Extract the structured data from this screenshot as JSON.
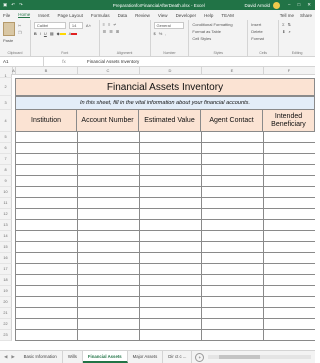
{
  "window": {
    "title": "PreparationforFinancialAfterDeath.xlsx - Excel",
    "user": "David Arnold",
    "controls": [
      "–",
      "□",
      "✕"
    ]
  },
  "qat": {
    "save": "▣",
    "undo": "↶",
    "redo": "↷"
  },
  "menu": {
    "tabs": [
      "File",
      "Home",
      "Insert",
      "Page Layout",
      "Formulas",
      "Data",
      "Review",
      "View",
      "Developer",
      "Help",
      "TEAM"
    ],
    "active": "Home",
    "tell_me": "Tell me",
    "share": "Share"
  },
  "ribbon": {
    "paste": "Paste",
    "font_name": "Calibri",
    "font_size": "14",
    "general": "General",
    "conditional": "Conditional Formatting",
    "format_table": "Format as Table",
    "cell_styles": "Cell Styles",
    "insert": "Insert",
    "delete": "Delete",
    "format": "Format",
    "groups": [
      "Clipboard",
      "Font",
      "Alignment",
      "Number",
      "Styles",
      "Cells",
      "Editing"
    ]
  },
  "formula_bar": {
    "name_box": "A1",
    "fx": "fx",
    "formula": "Financial Assets Inventory"
  },
  "columns": [
    "A",
    "B",
    "C",
    "D",
    "E",
    "F"
  ],
  "sheet": {
    "title": "Financial Assets Inventory",
    "subtitle": "In this sheet, fill in the vital information about your financial accounts.",
    "headers": [
      "Institution",
      "Account Number",
      "Estimated Value",
      "Agent Contact",
      "Intended Beneficiary"
    ],
    "row_numbers": [
      "1",
      "2",
      "3",
      "4",
      "5",
      "6",
      "7",
      "8",
      "9",
      "10",
      "11",
      "12",
      "13",
      "14",
      "15",
      "16",
      "17",
      "18",
      "19",
      "20",
      "21",
      "22",
      "23"
    ]
  },
  "sheet_tabs": {
    "tabs": [
      "Basic Information",
      "Wills",
      "Financial Assets",
      "Major Assets",
      "Dir ct c ..."
    ],
    "active": "Financial Assets",
    "add": "+"
  }
}
